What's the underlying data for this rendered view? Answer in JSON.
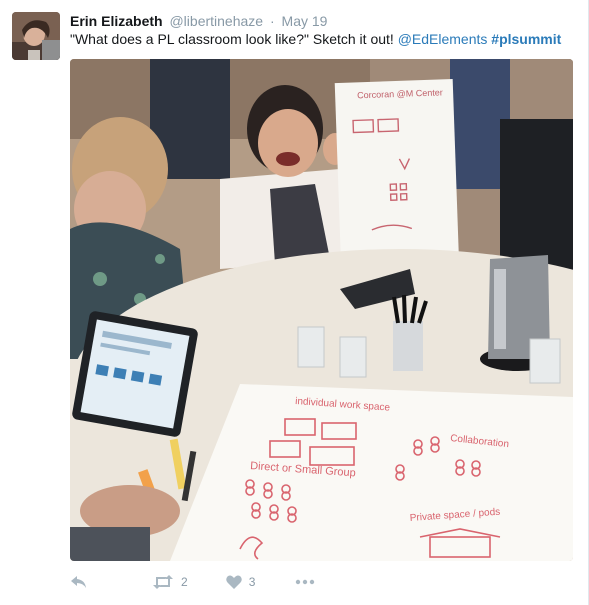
{
  "tweet": {
    "author_name": "Erin Elizabeth",
    "handle": "@libertinehaze",
    "separator": "·",
    "date": "May 19",
    "text_before": "\"What does a PL classroom look like?\" Sketch it out!",
    "mention": "@EdElements",
    "hashtag": "#plsummit"
  },
  "photo": {
    "poster_title": "Corcoran @M Center",
    "sketch": {
      "individual": "individual work space",
      "collaboration": "Collaboration",
      "direct": "Direct or Small Group",
      "private": "Private space / pods"
    }
  },
  "actions": {
    "reply_icon": "reply-icon",
    "retweet_icon": "retweet-icon",
    "retweet_count": "2",
    "like_icon": "heart-icon",
    "like_count": "3",
    "more_icon": "more-icon"
  },
  "colors": {
    "link": "#2b7bb9",
    "muted": "#8899a6",
    "icon": "#aab8c2",
    "sketch_ink": "#d9646e"
  }
}
